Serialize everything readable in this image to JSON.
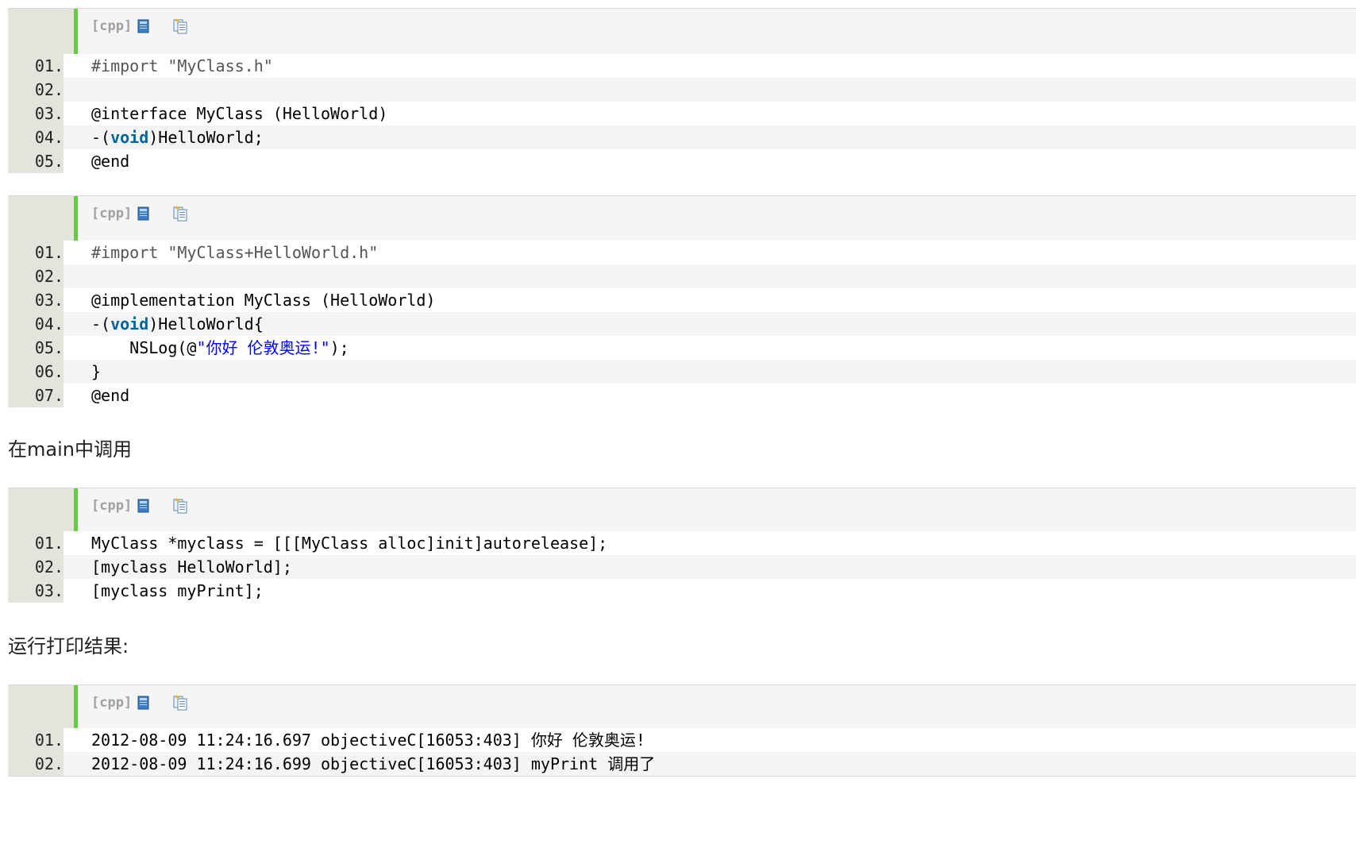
{
  "blocks": [
    {
      "lang": "[cpp]",
      "lines": [
        {
          "num": "01.",
          "segments": [
            {
              "t": "#import \"MyClass.h\"",
              "c": "pre"
            }
          ]
        },
        {
          "num": "02.",
          "segments": []
        },
        {
          "num": "03.",
          "segments": [
            {
              "t": "@interface MyClass (HelloWorld)",
              "c": ""
            }
          ]
        },
        {
          "num": "04.",
          "segments": [
            {
              "t": "-(",
              "c": ""
            },
            {
              "t": "void",
              "c": "kw"
            },
            {
              "t": ")HelloWorld;",
              "c": ""
            }
          ]
        },
        {
          "num": "05.",
          "segments": [
            {
              "t": "@end",
              "c": ""
            }
          ]
        }
      ]
    },
    {
      "lang": "[cpp]",
      "lines": [
        {
          "num": "01.",
          "segments": [
            {
              "t": "#import \"MyClass+HelloWorld.h\"",
              "c": "pre"
            }
          ]
        },
        {
          "num": "02.",
          "segments": []
        },
        {
          "num": "03.",
          "segments": [
            {
              "t": "@implementation MyClass (HelloWorld)",
              "c": ""
            }
          ]
        },
        {
          "num": "04.",
          "segments": [
            {
              "t": "-(",
              "c": ""
            },
            {
              "t": "void",
              "c": "kw"
            },
            {
              "t": ")HelloWorld{",
              "c": ""
            }
          ]
        },
        {
          "num": "05.",
          "segments": [
            {
              "t": "    NSLog(@",
              "c": ""
            },
            {
              "t": "\"你好 伦敦奥运!\"",
              "c": "str"
            },
            {
              "t": ");",
              "c": ""
            }
          ]
        },
        {
          "num": "06.",
          "segments": [
            {
              "t": "}",
              "c": ""
            }
          ]
        },
        {
          "num": "07.",
          "segments": [
            {
              "t": "@end",
              "c": ""
            }
          ]
        }
      ]
    },
    {
      "lang": "[cpp]",
      "lines": [
        {
          "num": "01.",
          "segments": [
            {
              "t": "MyClass *myclass = [[[MyClass alloc]init]autorelease];",
              "c": ""
            }
          ]
        },
        {
          "num": "02.",
          "segments": [
            {
              "t": "[myclass HelloWorld];",
              "c": ""
            }
          ]
        },
        {
          "num": "03.",
          "segments": [
            {
              "t": "[myclass myPrint];",
              "c": ""
            }
          ]
        }
      ]
    },
    {
      "lang": "[cpp]",
      "lines": [
        {
          "num": "01.",
          "segments": [
            {
              "t": "2012-08-09 11:24:16.697 objectiveC[16053:403] 你好 伦敦奥运!",
              "c": ""
            }
          ]
        },
        {
          "num": "02.",
          "segments": [
            {
              "t": "2012-08-09 11:24:16.699 objectiveC[16053:403] myPrint 调用了",
              "c": ""
            }
          ]
        }
      ]
    }
  ],
  "prose": {
    "main_call": "在main中调用",
    "run_result": "运行打印结果:"
  },
  "icons": {
    "view_source": "view-source-icon",
    "copy": "copy-icon"
  }
}
